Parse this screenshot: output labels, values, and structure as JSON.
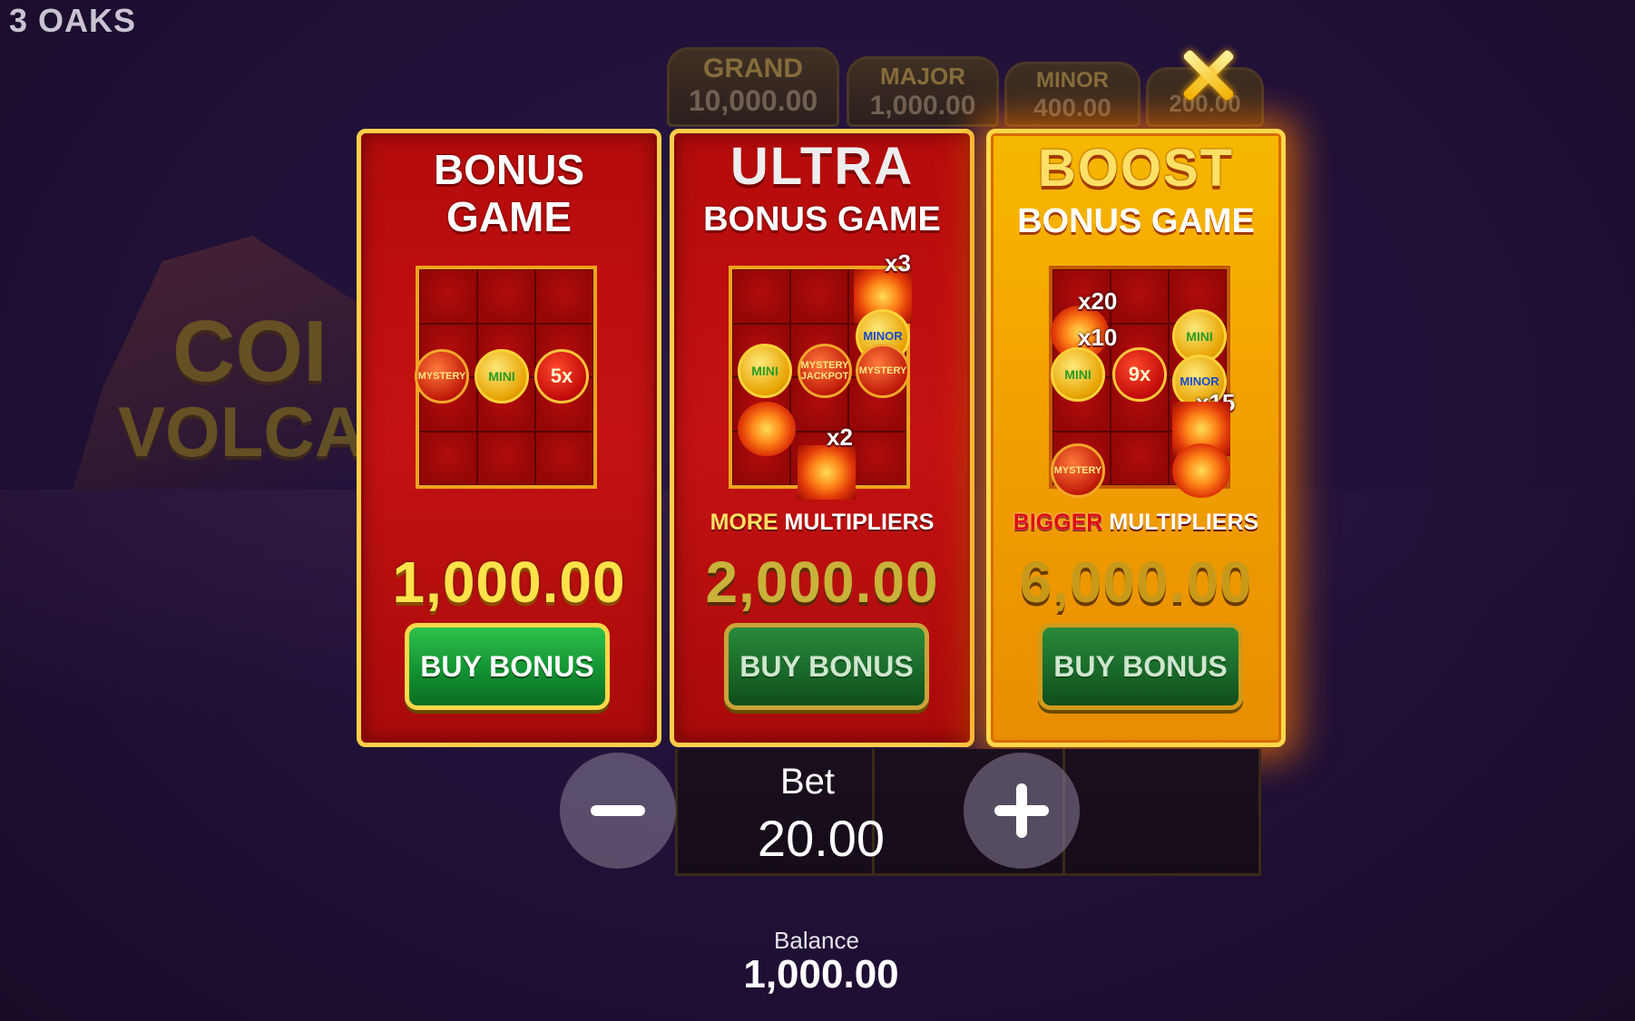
{
  "brand": "3 OAKS",
  "background_logo": {
    "line1": "COI",
    "line2": "VOLCA"
  },
  "jackpots": [
    {
      "label": "GRAND",
      "value": "10,000.00"
    },
    {
      "label": "MAJOR",
      "value": "1,000.00"
    },
    {
      "label": "MINOR",
      "value": "400.00"
    },
    {
      "label": "",
      "value": "200.00"
    }
  ],
  "close_icon": "close-icon",
  "cards": [
    {
      "title_line1": "BONUS",
      "title_line2": "GAME",
      "tagline_highlight": "",
      "tagline_rest": "",
      "price": "1,000.00",
      "button": "BUY BONUS",
      "symbols": {
        "mystery": "MYSTERY",
        "mini": "MINI",
        "mult": "5x"
      }
    },
    {
      "title_line1": "ULTRA",
      "title_line2": "BONUS GAME",
      "tagline_highlight": "MORE",
      "tagline_rest": " MULTIPLIERS",
      "price": "2,000.00",
      "button": "BUY BONUS",
      "symbols": {
        "mini": "MINI",
        "jackpot": "MYSTERY JACKPOT",
        "mystery": "MYSTERY",
        "minor": "MINOR",
        "x3": "x3",
        "x2": "x2"
      }
    },
    {
      "title_line1": "BOOST",
      "title_line2": "BONUS GAME",
      "tagline_highlight": "BIGGER",
      "tagline_rest": " MULTIPLIERS",
      "price": "6,000.00",
      "button": "BUY BONUS",
      "symbols": {
        "mini1": "MINI",
        "mini2": "MINI",
        "mult": "9x",
        "minor": "MINOR",
        "mystery": "MYSTERY",
        "x20": "x20",
        "x10": "x10",
        "x15": "x15"
      }
    }
  ],
  "bet": {
    "label": "Bet",
    "value": "20.00"
  },
  "balance": {
    "label": "Balance",
    "value": "1,000.00"
  },
  "colors": {
    "card_red": "#c41212",
    "card_gold": "#f3a300",
    "button_green": "#129232",
    "accent_yellow": "#ffe24a"
  }
}
